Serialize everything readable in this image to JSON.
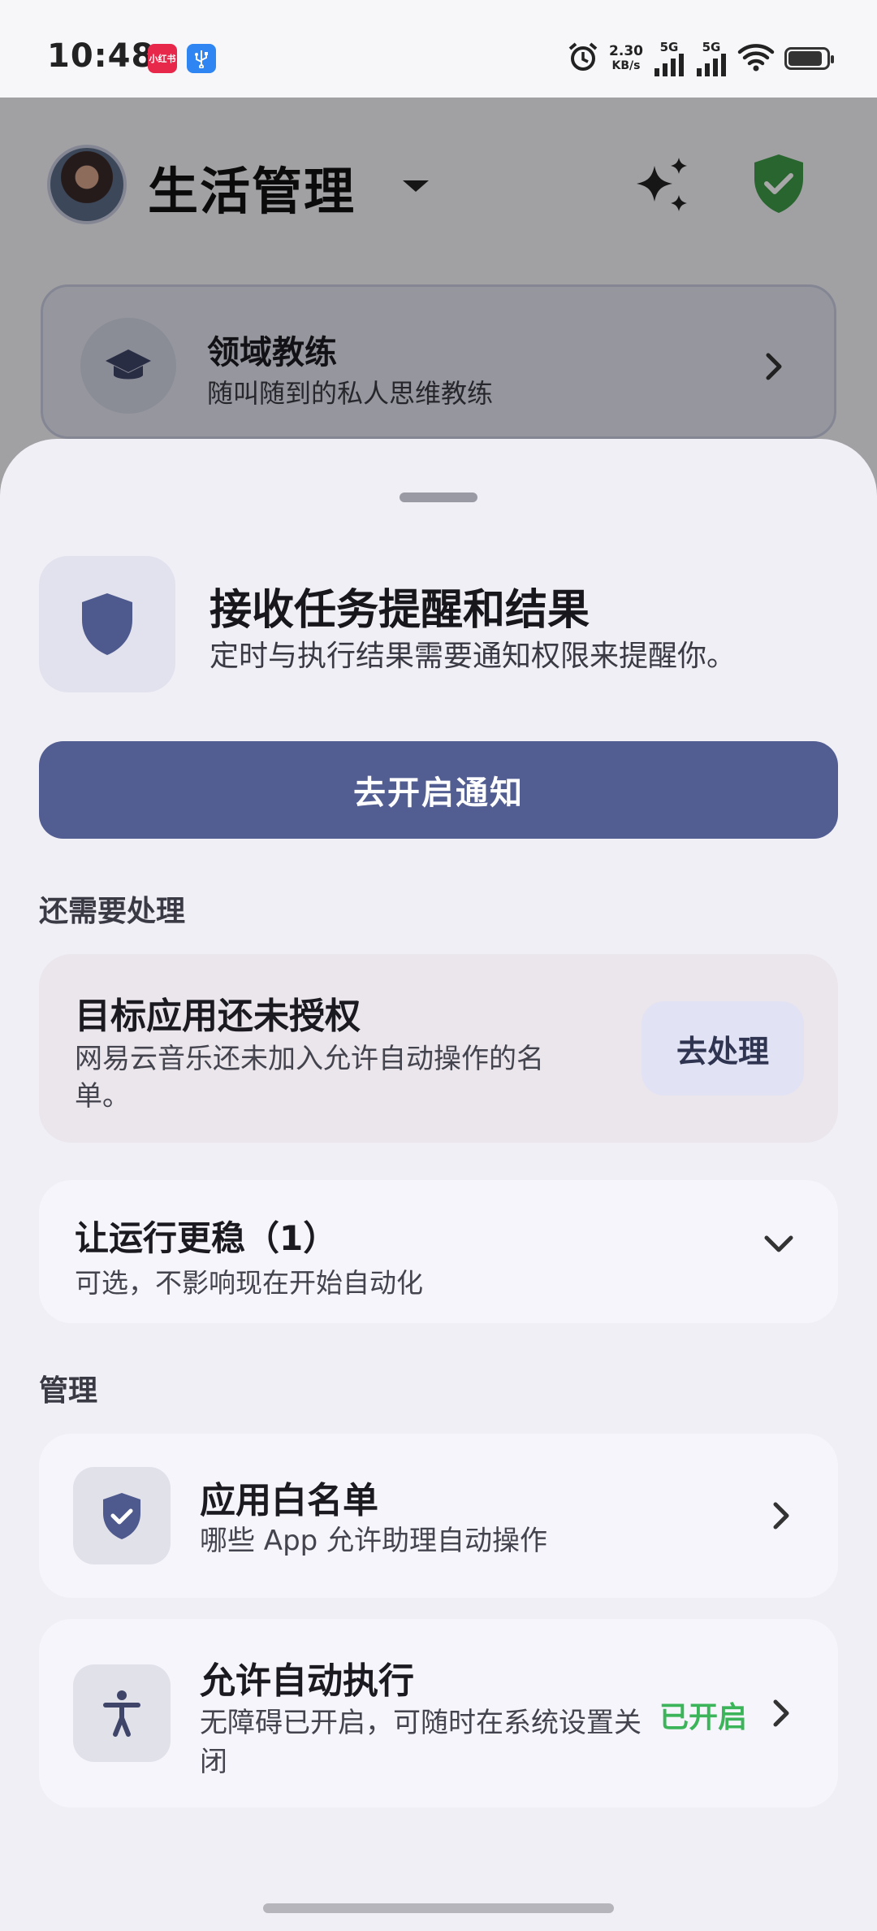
{
  "status_bar": {
    "time": "10:48",
    "app_icons": [
      "小红书",
      "USB"
    ],
    "net_speed_value": "2.30",
    "net_speed_unit": "KB/s",
    "signal_1": "5G",
    "signal_2": "5G",
    "icons": [
      "alarm-icon",
      "signal-icon",
      "signal-icon",
      "wifi-icon",
      "battery-icon"
    ],
    "battery_level": 0.9
  },
  "header": {
    "title": "生活管理",
    "dropdown_icon": "caret-down-icon",
    "sparkle_icon": "sparkle-icon",
    "shield_icon": "shield-check-icon",
    "shield_color": "#3e9a48"
  },
  "coach_card": {
    "title": "领域教练",
    "subtitle": "随叫随到的私人思维教练",
    "icon": "graduation-cap-icon"
  },
  "sheet": {
    "permission": {
      "icon": "shield-icon",
      "title": "接收任务提醒和结果",
      "subtitle": "定时与执行结果需要通知权限来提醒你。"
    },
    "primary_button": "去开启通知",
    "pending_section_label": "还需要处理",
    "pending_card": {
      "title": "目标应用还未授权",
      "subtitle": "网易云音乐还未加入允许自动操作的名单。",
      "button": "去处理"
    },
    "stability_card": {
      "title": "让运行更稳（1）",
      "subtitle": "可选，不影响现在开始自动化"
    },
    "manage_section_label": "管理",
    "manage_items": [
      {
        "icon": "shield-check-icon",
        "title": "应用白名单",
        "subtitle": "哪些 App 允许助理自动操作",
        "status": ""
      },
      {
        "icon": "accessibility-icon",
        "title": "允许自动执行",
        "subtitle": "无障碍已开启，可随时在系统设置关闭",
        "status": "已开启"
      }
    ]
  },
  "colors": {
    "primary": "#525d92",
    "enabled_status": "#3cb55a"
  }
}
